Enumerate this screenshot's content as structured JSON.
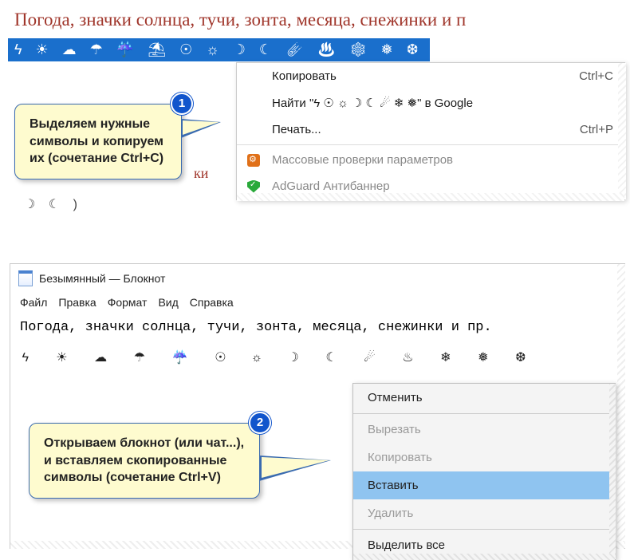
{
  "page_title": "Погода, значки солнца, тучи, зонта, месяца, снежинки и п",
  "selected_symbols": "ϟ ☀ ☁ ☂ ☔ ⛱ ☉ ☼ ☽ ☾ ☄ ♨ ❄ ❅ ❆",
  "context_menu_1": {
    "copy": "Копировать",
    "copy_shortcut": "Ctrl+C",
    "find": "Найти \"ϟ   ☉ ☼ ☽ ☾ ☄  ❄ ❅\" в Google",
    "print": "Печать...",
    "print_shortcut": "Ctrl+P",
    "ext1": "Массовые проверки параметров",
    "ext2": "AdGuard Антибаннер"
  },
  "callout_1": {
    "badge": "1",
    "text": "Выделяем нужные символы и копируем их (сочетание Ctrl+C)"
  },
  "red_fragment": "ки",
  "row2_symbols": "☽ ☾ )",
  "notepad": {
    "title": "Безымянный — Блокнот",
    "menus": [
      "Файл",
      "Правка",
      "Формат",
      "Вид",
      "Справка"
    ],
    "body": "Погода, значки солнца, тучи, зонта, месяца, снежинки и пр.",
    "symbols": "ϟ ☀ ☁ ☂ ☔ ☉ ☼ ☽ ☾ ☄ ♨ ❄ ❅ ❆"
  },
  "callout_2": {
    "badge": "2",
    "text": "Открываем блокнот (или чат...), и вставляем скопированные символы (сочетание Ctrl+V)"
  },
  "context_menu_2": {
    "undo": "Отменить",
    "cut": "Вырезать",
    "copy": "Копировать",
    "paste": "Вставить",
    "delete": "Удалить",
    "select_all": "Выделить все"
  }
}
